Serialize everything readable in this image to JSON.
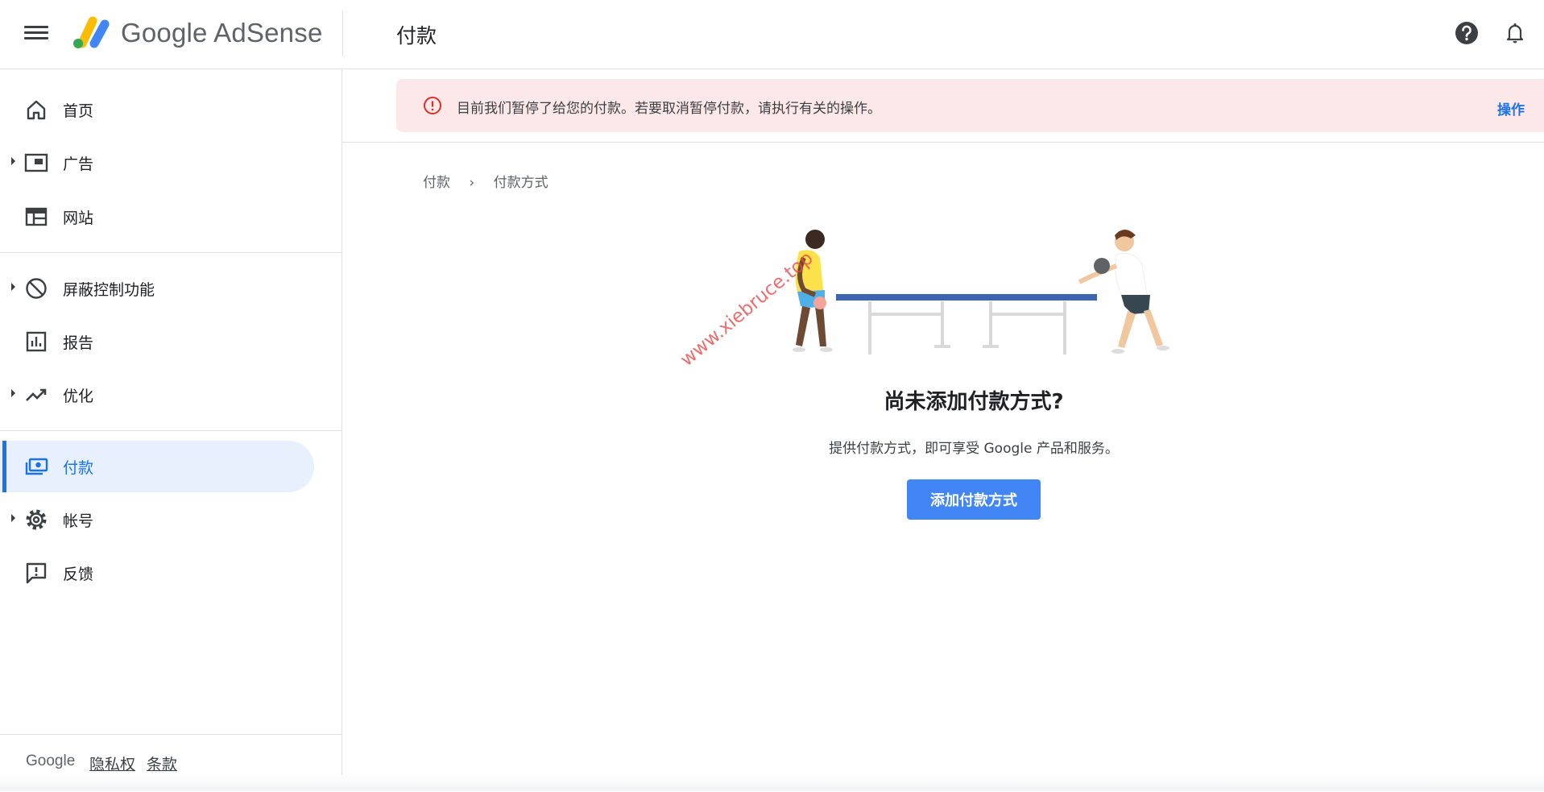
{
  "header": {
    "brand": "Google AdSense",
    "page_title": "付款"
  },
  "sidebar": {
    "items": [
      {
        "label": "首页",
        "icon": "home-icon"
      },
      {
        "label": "广告",
        "icon": "ads-icon"
      },
      {
        "label": "网站",
        "icon": "sites-icon"
      },
      {
        "label": "屏蔽控制功能",
        "icon": "block-icon"
      },
      {
        "label": "报告",
        "icon": "reports-icon"
      },
      {
        "label": "优化",
        "icon": "optimize-icon"
      },
      {
        "label": "付款",
        "icon": "payments-icon",
        "active": true
      },
      {
        "label": "帐号",
        "icon": "gear-icon"
      },
      {
        "label": "反馈",
        "icon": "feedback-icon"
      }
    ],
    "footer": {
      "google": "Google",
      "privacy": "隐私权",
      "terms": "条款"
    }
  },
  "banner": {
    "message": "目前我们暂停了给您的付款。若要取消暂停付款，请执行有关的操作。",
    "action": "操作"
  },
  "breadcrumb": {
    "parent": "付款",
    "separator": "›",
    "current": "付款方式"
  },
  "empty_state": {
    "title": "尚未添加付款方式?",
    "description": "提供付款方式，即可享受 Google 产品和服务。",
    "button": "添加付款方式"
  },
  "watermark": "www.xiebruce.top",
  "colors": {
    "accent": "#1a73e8",
    "button": "#4285f4",
    "banner_bg": "#fce8e8",
    "error": "#d93025"
  }
}
